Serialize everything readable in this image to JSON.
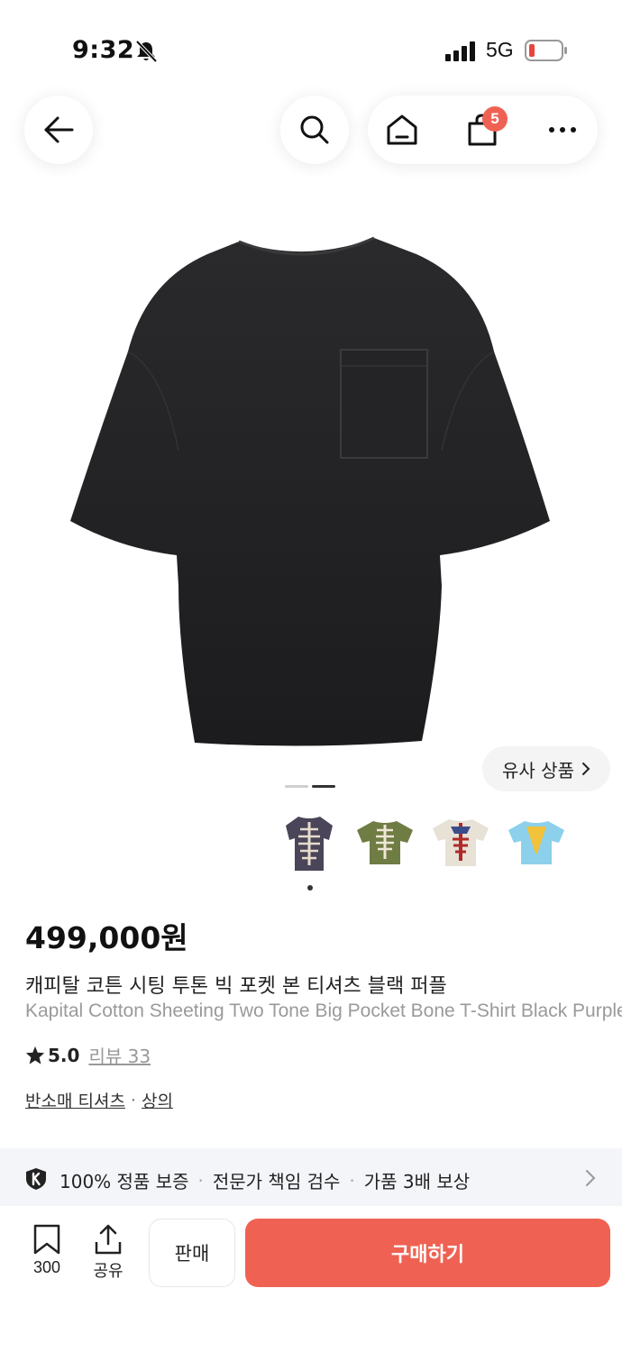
{
  "status_bar": {
    "time": "9:32",
    "network": "5G"
  },
  "nav": {
    "cart_count": "5"
  },
  "similar_button": {
    "label": "유사 상품"
  },
  "product": {
    "price": "499,000원",
    "title_ko": "캐피탈 코튼 시팅 투톤 빅 포켓 본 티셔츠 블랙 퍼플",
    "title_en": "Kapital Cotton Sheeting Two Tone Big Pocket Bone T-Shirt Black Purple",
    "rating": "5.0",
    "review_label": "리뷰 33",
    "category": {
      "sub": "반소매 티셔츠",
      "separator": "·",
      "main": "상의"
    }
  },
  "thumbnails": [
    {
      "name": "black-purple",
      "color": "#4a4558"
    },
    {
      "name": "olive",
      "color": "#6f7c43"
    },
    {
      "name": "cream",
      "color": "#e8e1d6"
    },
    {
      "name": "sky-blue",
      "color": "#8cd0ec"
    }
  ],
  "guarantee": {
    "item1": "100% 정품 보증",
    "item2": "전문가 책임 검수",
    "item3": "가품 3배 보상",
    "separator": "·"
  },
  "bottom_bar": {
    "bookmark_count": "300",
    "share_label": "공유",
    "sell_label": "판매",
    "buy_label": "구매하기"
  },
  "colors": {
    "accent": "#ef6253",
    "banner_bg": "#f3f5f9"
  }
}
